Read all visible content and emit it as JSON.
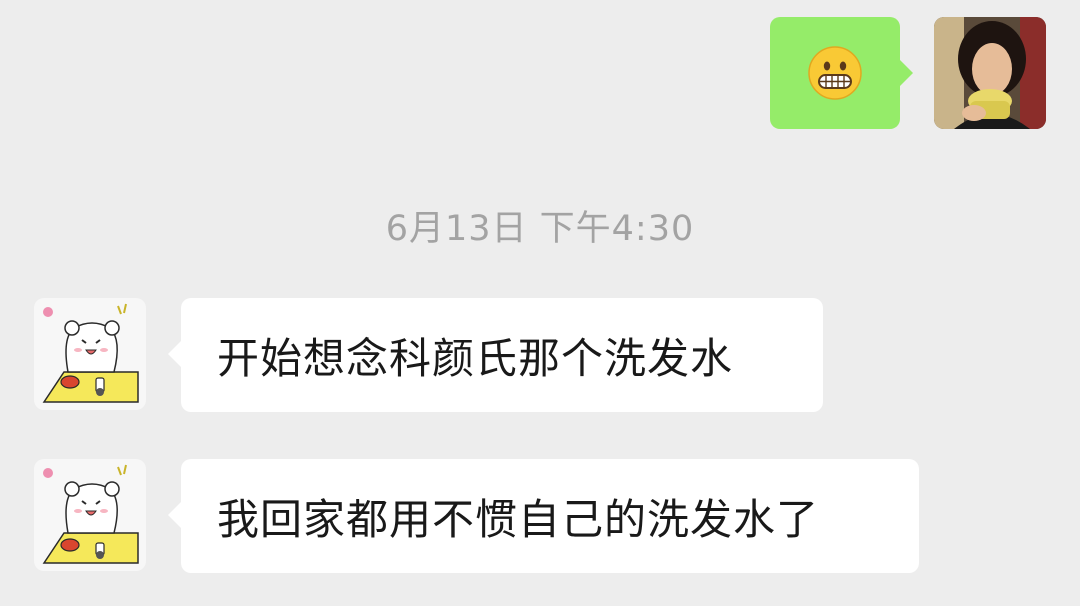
{
  "conversation": {
    "messages": [
      {
        "sender": "me",
        "type": "emoji",
        "emoji": "😬",
        "icon": "grimacing-face-icon"
      },
      {
        "type": "timestamp",
        "text": "6月13日 下午4:30"
      },
      {
        "sender": "friend",
        "type": "text",
        "text": "开始想念科颜氏那个洗发水"
      },
      {
        "sender": "friend",
        "type": "text",
        "text": "我回家都用不惯自己的洗发水了"
      }
    ]
  },
  "avatars": {
    "me": "woman-drinking-avatar",
    "friend": "white-bear-sticker-avatar"
  },
  "colors": {
    "background": "#ededed",
    "sent_bubble": "#95ec69",
    "received_bubble": "#ffffff",
    "timestamp_text": "#a3a3a3",
    "message_text": "#191919"
  }
}
